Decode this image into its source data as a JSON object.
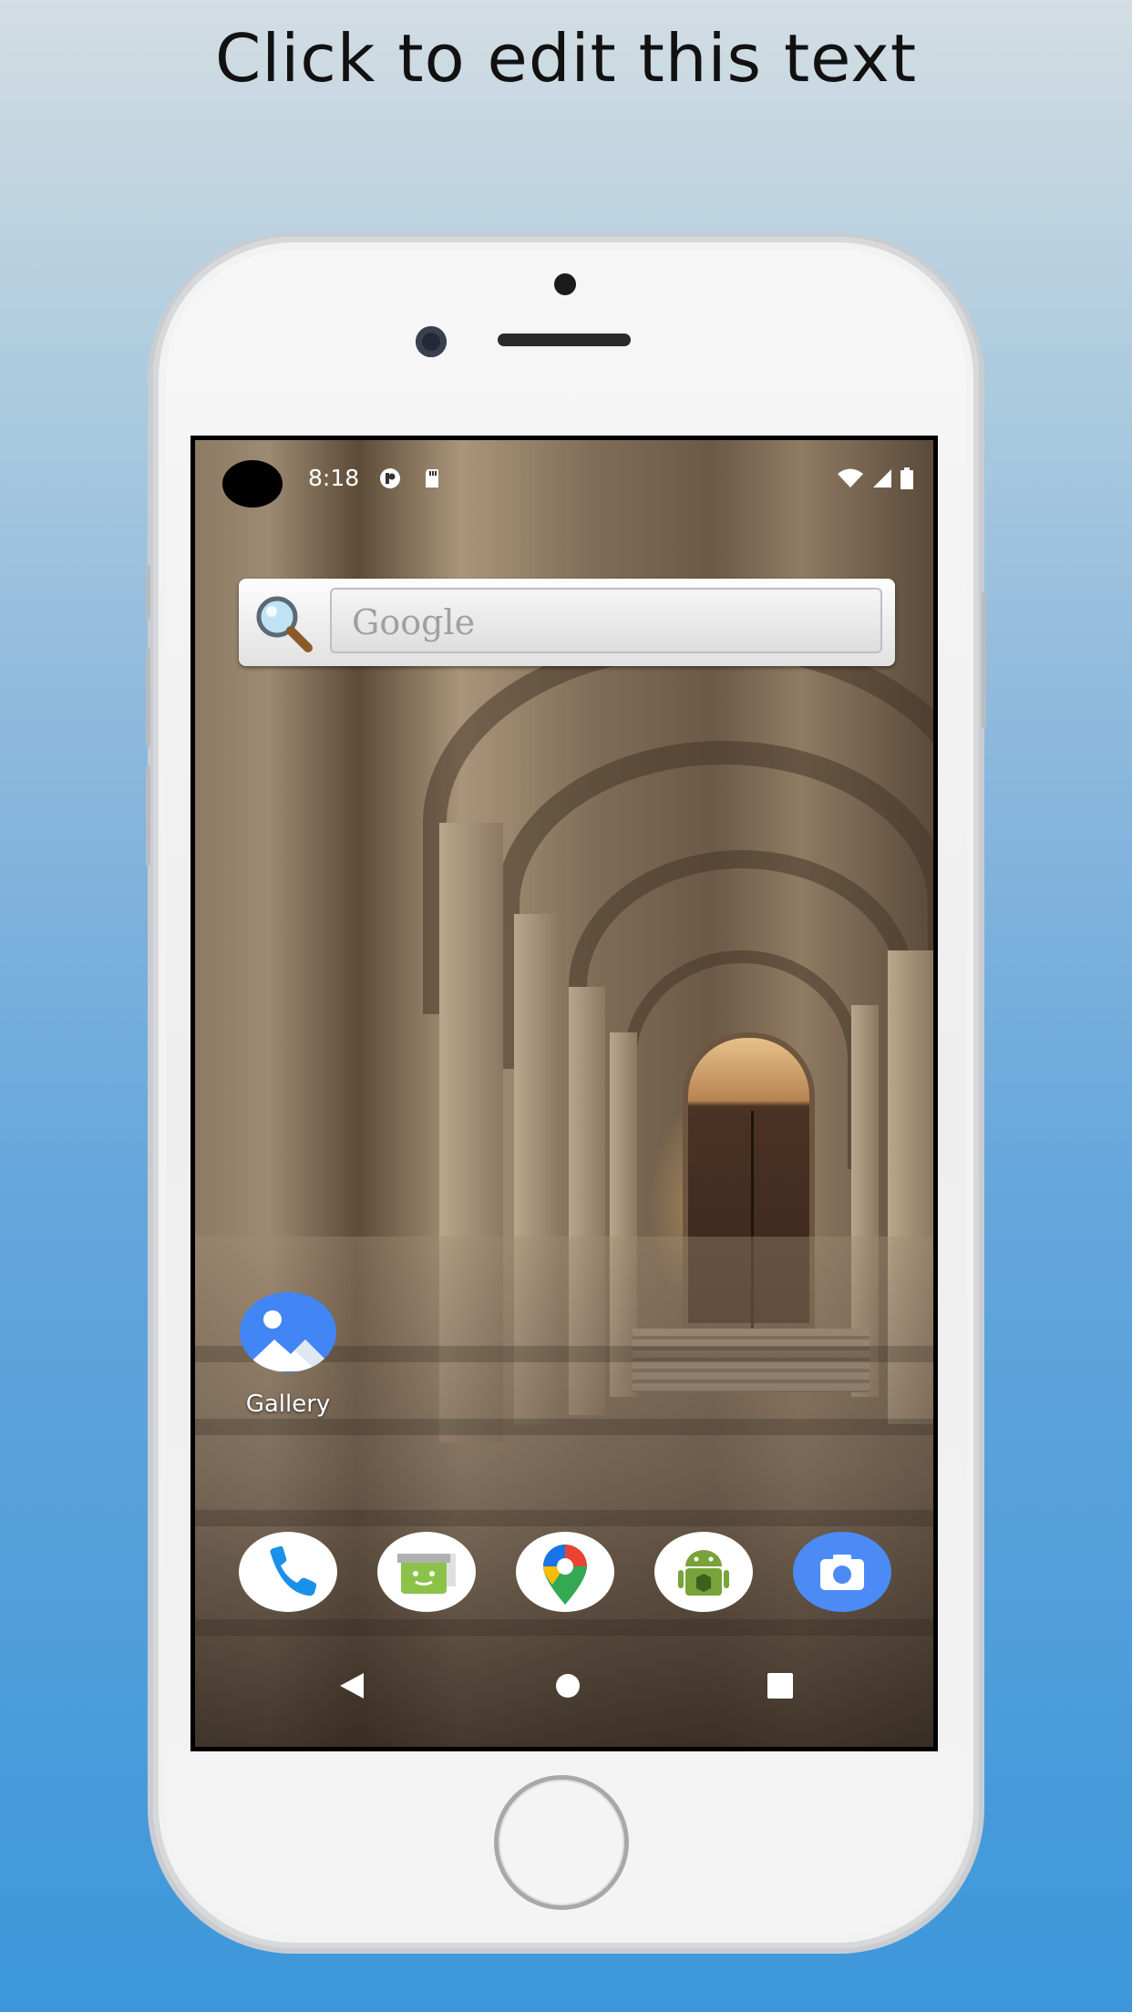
{
  "headline": "Click to edit this text",
  "status_bar": {
    "time": "8:18",
    "icons": [
      "notification-app-icon",
      "sd-card-icon",
      "wifi-icon",
      "signal-icon",
      "battery-icon"
    ]
  },
  "search_widget": {
    "placeholder": "Google",
    "icon": "magnifier-icon"
  },
  "home_apps": [
    {
      "label": "Gallery",
      "icon": "gallery-icon"
    }
  ],
  "dock": [
    {
      "icon": "phone-icon"
    },
    {
      "icon": "messaging-icon"
    },
    {
      "icon": "maps-icon"
    },
    {
      "icon": "android-app-icon"
    },
    {
      "icon": "camera-icon"
    }
  ],
  "navigation": [
    "back-icon",
    "home-icon",
    "recents-icon"
  ],
  "colors": {
    "background_top": "#d3dde3",
    "background_bottom": "#3d97da",
    "phone_body": "#f2f2f2",
    "gallery_blue": "#4285f4",
    "camera_blue": "#4c8bf5"
  }
}
